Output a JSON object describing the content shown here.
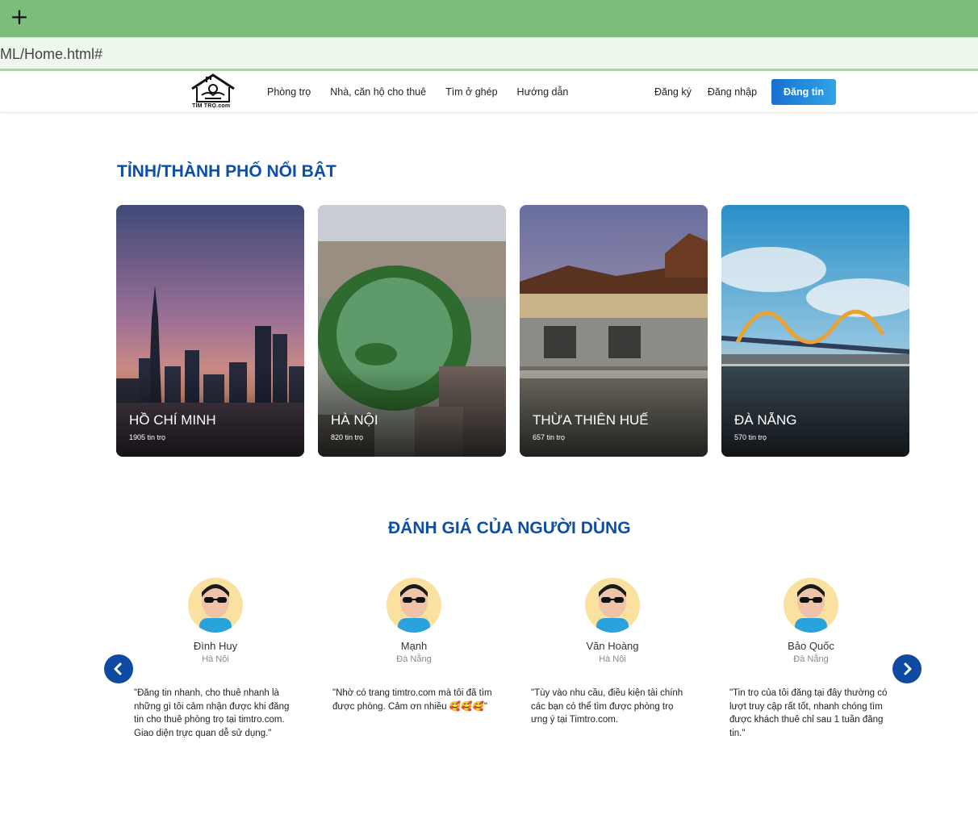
{
  "browser": {
    "new_tab_symbol": "+",
    "url": "ML/Home.html#"
  },
  "header": {
    "logo_text": "TÌM TRỌ.com",
    "nav_left": [
      "Phòng trọ",
      "Nhà, căn hộ cho thuê",
      "Tìm ở ghép",
      "Hướng dẫn"
    ],
    "nav_right": [
      "Đăng ký",
      "Đăng nhập"
    ],
    "post_button": "Đăng tin"
  },
  "cities_section": {
    "title": "TỈNH/THÀNH PHỐ NỔI BẬT",
    "cities": [
      {
        "name": "HỒ CHÍ MINH",
        "count": "1905 tin trọ"
      },
      {
        "name": "HÀ NỘI",
        "count": "820 tin trọ"
      },
      {
        "name": "THỪA THIÊN HUẾ",
        "count": "657 tin trọ"
      },
      {
        "name": "ĐÀ NẴNG",
        "count": "570 tin trọ"
      }
    ]
  },
  "reviews_section": {
    "title": "ĐÁNH GIÁ CỦA NGƯỜI DÙNG",
    "reviews": [
      {
        "name": "Đình Huy",
        "city": "Hà Nội",
        "text": "\"Đăng tin nhanh, cho thuê nhanh là những gì tôi cảm nhận được khi đăng tin cho thuê phòng trọ tại timtro.com. Giao diện trực quan dễ sử dụng.\""
      },
      {
        "name": "Mạnh",
        "city": "Đà Nẵng",
        "text": "\"Nhờ có trang timtro.com mà tôi đã tìm được phòng. Cảm ơn nhiều 🥰🥰🥰\""
      },
      {
        "name": "Văn Hoàng",
        "city": "Hà Nội",
        "text": "\"Tùy vào nhu cầu, điều kiện tài chính các bạn có thể tìm được phòng trọ ưng ý tại Timtro.com."
      },
      {
        "name": "Bảo Quốc",
        "city": "Đà Nẵng",
        "text": "\"Tin trọ của tôi đăng tại đây thường có lượt truy cập rất tốt, nhanh chóng tìm được khách thuê chỉ sau 1 tuần đăng tin.\""
      }
    ],
    "prev_icon": "chevron-left-icon",
    "next_icon": "chevron-right-icon"
  },
  "colors": {
    "accent": "#0d4fa6",
    "tabbar": "#7bbd7a",
    "button_start": "#1a6fd0",
    "button_end": "#2fa5e6"
  }
}
